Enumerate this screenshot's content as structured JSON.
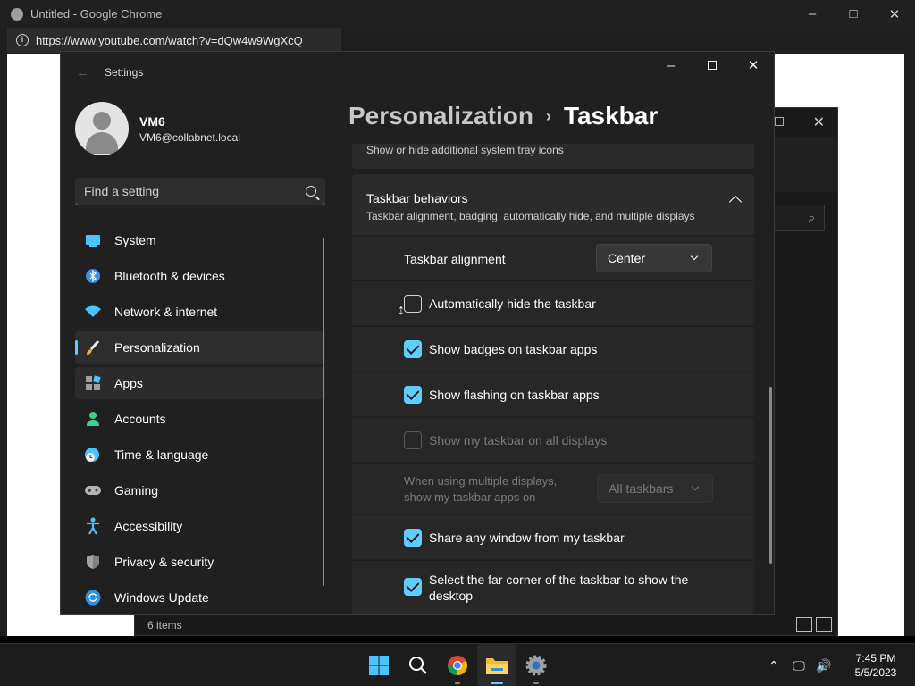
{
  "chrome": {
    "title": "Untitled - Google Chrome",
    "url": "https://www.youtube.com/watch?v=dQw4w9WgXcQ",
    "info_icon": "i"
  },
  "explorer": {
    "status": "6 items"
  },
  "settings": {
    "window_title": "Settings",
    "user": {
      "name": "VM6",
      "email": "VM6@collabnet.local"
    },
    "search_placeholder": "Find a setting",
    "nav": [
      {
        "label": "System",
        "icon": "system-icon"
      },
      {
        "label": "Bluetooth & devices",
        "icon": "bluetooth-icon"
      },
      {
        "label": "Network & internet",
        "icon": "wifi-icon"
      },
      {
        "label": "Personalization",
        "icon": "brush-icon"
      },
      {
        "label": "Apps",
        "icon": "apps-icon"
      },
      {
        "label": "Accounts",
        "icon": "person-icon"
      },
      {
        "label": "Time & language",
        "icon": "clock-globe-icon"
      },
      {
        "label": "Gaming",
        "icon": "gamepad-icon"
      },
      {
        "label": "Accessibility",
        "icon": "accessibility-icon"
      },
      {
        "label": "Privacy & security",
        "icon": "shield-icon"
      },
      {
        "label": "Windows Update",
        "icon": "update-icon"
      }
    ],
    "breadcrumb": {
      "parent": "Personalization",
      "separator": "›",
      "current": "Taskbar"
    },
    "tray_card_desc": "Show or hide additional system tray icons",
    "behaviors": {
      "title": "Taskbar behaviors",
      "description": "Taskbar alignment, badging, automatically hide, and multiple displays",
      "alignment_label": "Taskbar alignment",
      "alignment_value": "Center",
      "auto_hide": "Automatically hide the taskbar",
      "badges": "Show badges on taskbar apps",
      "flashing": "Show flashing on taskbar apps",
      "all_displays": "Show my taskbar on all displays",
      "multi_display_label_line1": "When using multiple displays,",
      "multi_display_label_line2": "show my taskbar apps on",
      "multi_display_value": "All taskbars",
      "share_window": "Share any window from my taskbar",
      "far_corner_line1": "Select the far corner of the taskbar to show the",
      "far_corner_line2": "desktop"
    }
  },
  "taskbar": {
    "time": "7:45 PM",
    "date": "5/5/2023"
  },
  "colors": {
    "accent": "#60cdff",
    "window_bg": "#202020",
    "card_bg": "#2b2b2b"
  }
}
